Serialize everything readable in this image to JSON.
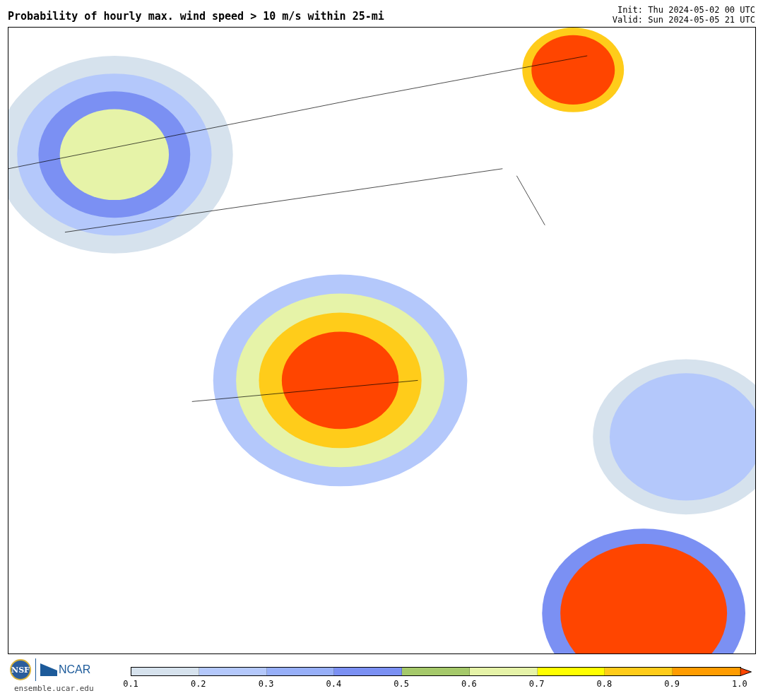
{
  "title": "Probability of hourly max. wind speed > 10 m/s within 25-mi",
  "init": "Init: Thu 2024-05-02 00 UTC",
  "valid": "Valid: Sun 2024-05-05 21 UTC",
  "logos": {
    "nsf": "NSF",
    "ncar": "NCAR",
    "url": "ensemble.ucar.edu"
  },
  "colorbar": {
    "bins": [
      {
        "color": "#d6e2ed"
      },
      {
        "color": "#b4c8fb"
      },
      {
        "color": "#97aff8"
      },
      {
        "color": "#7b90f3"
      },
      {
        "color": "#a5c96a"
      },
      {
        "color": "#e6f3a8"
      },
      {
        "color": "#ffff00"
      },
      {
        "color": "#ffcc1a"
      },
      {
        "color": "#ff9c00"
      }
    ],
    "overflow": {
      "color": "#ff4500"
    },
    "ticks": [
      "0.1",
      "0.2",
      "0.3",
      "0.4",
      "0.5",
      "0.6",
      "0.7",
      "0.8",
      "0.9",
      "1.0"
    ]
  }
}
